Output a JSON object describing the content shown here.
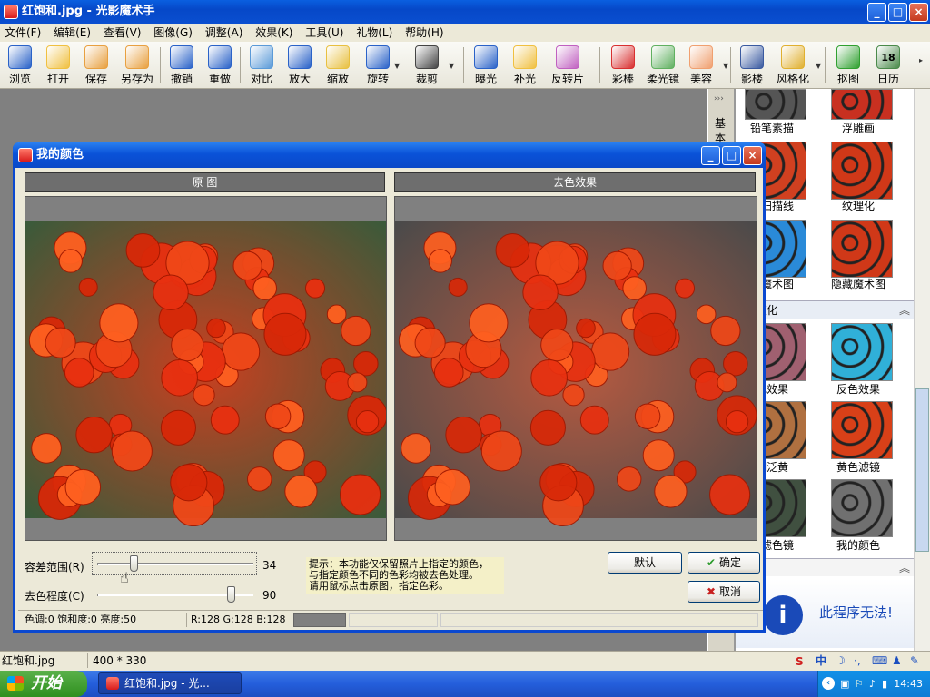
{
  "app": {
    "title": "红饱和.jpg - 光影魔术手",
    "window_buttons": [
      "_",
      "□",
      "×"
    ]
  },
  "menu": [
    "文件(F)",
    "编辑(E)",
    "查看(V)",
    "图像(G)",
    "调整(A)",
    "效果(K)",
    "工具(U)",
    "礼物(L)",
    "帮助(H)"
  ],
  "toolbar": {
    "items": [
      {
        "label": "浏览",
        "icon": "eye-icon",
        "color": "#2a62c8"
      },
      {
        "label": "打开",
        "icon": "folder-icon",
        "color": "#f0c040"
      },
      {
        "label": "保存",
        "icon": "save-icon",
        "color": "#e8a040"
      },
      {
        "label": "另存为",
        "icon": "save-as-icon",
        "color": "#e8a040"
      },
      {
        "label": "撤销",
        "icon": "undo-icon",
        "color": "#2a62c8"
      },
      {
        "label": "重做",
        "icon": "redo-icon",
        "color": "#2a62c8"
      },
      {
        "label": "对比",
        "icon": "compare-icon",
        "color": "#5a9ad8"
      },
      {
        "label": "放大",
        "icon": "zoom-in-icon",
        "color": "#2a62c8"
      },
      {
        "label": "缩放",
        "icon": "resize-icon",
        "color": "#e8c040"
      },
      {
        "label": "旋转",
        "icon": "rotate-icon",
        "color": "#2a62c8"
      },
      {
        "label": "裁剪",
        "icon": "crop-icon",
        "color": "#444444"
      },
      {
        "label": "曝光",
        "icon": "exposure-icon",
        "color": "#2a62c8"
      },
      {
        "label": "补光",
        "icon": "fill-light-icon",
        "color": "#f0c040"
      },
      {
        "label": "反转片",
        "icon": "reversal-film-icon",
        "color": "#c060c0"
      },
      {
        "label": "彩棒",
        "icon": "color-wand-icon",
        "color": "#d83030"
      },
      {
        "label": "柔光镜",
        "icon": "soft-focus-icon",
        "color": "#60b060"
      },
      {
        "label": "美容",
        "icon": "beauty-icon",
        "color": "#f0a070"
      },
      {
        "label": "影楼",
        "icon": "studio-icon",
        "color": "#3a5aa0"
      },
      {
        "label": "风格化",
        "icon": "stylize-icon",
        "color": "#e0b030"
      },
      {
        "label": "抠图",
        "icon": "cutout-icon",
        "color": "#30a030"
      },
      {
        "label": "日历",
        "icon": "calendar-icon",
        "color": "#4a8a4a"
      }
    ],
    "calendar_day": "18"
  },
  "dialog": {
    "title": "我的颜色",
    "left_pane_title": "原 图",
    "right_pane_title": "去色效果",
    "slider1": {
      "label": "容差范围(R)",
      "value": "34",
      "level": 0.34
    },
    "slider2": {
      "label": "去色程度(C)",
      "value": "90",
      "level": 0.9
    },
    "hint_lines": [
      "提示：本功能仅保留照片上指定的颜色，",
      "与指定颜色不同的色彩均被去色处理。",
      "请用鼠标点击原图，指定色彩。"
    ],
    "btn_default": "默认",
    "btn_ok": "确定",
    "btn_cancel": "取消",
    "status_hsl": "色调:0 饱和度:0 亮度:50",
    "status_rgb": "R:128 G:128 B:128"
  },
  "side_panel": {
    "tab_label": "基本",
    "thumbs": [
      {
        "label": "铅笔素描",
        "color": "#555555"
      },
      {
        "label": "浮雕画",
        "color": "#c83020"
      },
      {
        "label": "视扫描线",
        "color": "#d04020"
      },
      {
        "label": "纹理化",
        "color": "#d03818"
      },
      {
        "label": "白魔术图",
        "color": "#2a8ad8"
      },
      {
        "label": "隐藏魔术图",
        "color": "#d03818"
      },
      {
        "label": "色效果",
        "color": "#a06070"
      },
      {
        "label": "反色效果",
        "color": "#30b0d8"
      },
      {
        "label": "调泛黄",
        "color": "#b07040"
      },
      {
        "label": "黄色滤镜",
        "color": "#d84018"
      },
      {
        "label": "字滤色镜",
        "color": "#405040"
      },
      {
        "label": "我的颜色",
        "color": "#707070"
      }
    ],
    "section_label": "变化",
    "bottom_text": "此程序无法!"
  },
  "statusbar": {
    "filename": "红饱和.jpg",
    "size": "400 * 330"
  },
  "taskbar": {
    "start": "开始",
    "task": "红饱和.jpg - 光...",
    "ime": "中",
    "clock": "14:43"
  }
}
